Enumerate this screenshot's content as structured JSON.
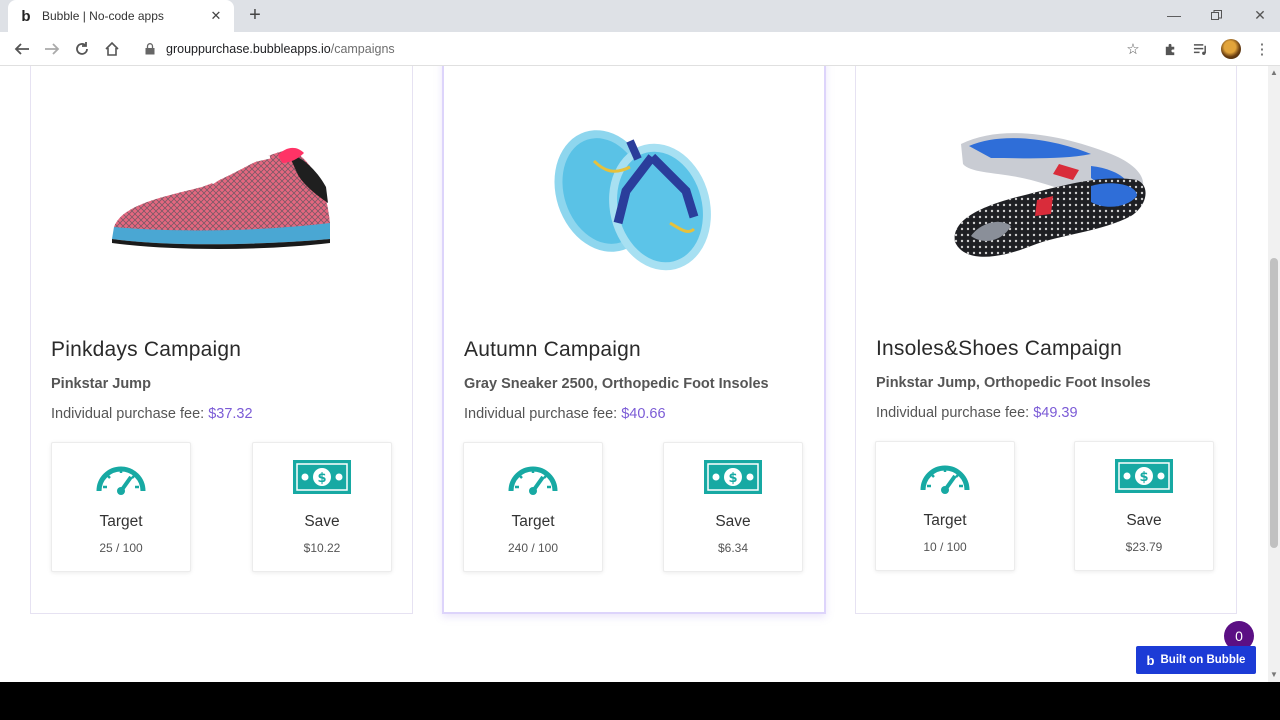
{
  "browser": {
    "tab_title": "Bubble | No-code apps",
    "tab_favicon": "b",
    "url_host": "grouppurchase.bubbleapps.io",
    "url_path": "/campaigns"
  },
  "colors": {
    "accent_purple": "#7b5bd6",
    "icon_teal": "#17a9a3",
    "bubble_blue": "#1c3bd6",
    "badge_purple": "#5b0f84"
  },
  "campaigns": [
    {
      "title": "Pinkdays Campaign",
      "products": "Pinkstar Jump",
      "fee_label": "Individual purchase fee:",
      "fee_amount": "$37.32",
      "target_label": "Target",
      "target_value": "25 / 100",
      "save_label": "Save",
      "save_value": "$10.22",
      "image": "pink-sneaker-image"
    },
    {
      "title": "Autumn Campaign",
      "products": "Gray Sneaker 2500, Orthopedic Foot Insoles",
      "fee_label": "Individual purchase fee:",
      "fee_amount": "$40.66",
      "target_label": "Target",
      "target_value": "240 / 100",
      "save_label": "Save",
      "save_value": "$6.34",
      "image": "flip-flops-image"
    },
    {
      "title": "Insoles&Shoes Campaign",
      "products": "Pinkstar Jump, Orthopedic Foot Insoles",
      "fee_label": "Individual purchase fee:",
      "fee_amount": "$49.39",
      "target_label": "Target",
      "target_value": "10 / 100",
      "save_label": "Save",
      "save_value": "$23.79",
      "image": "insoles-image"
    }
  ],
  "badge_count": "0",
  "built_on_label": "Built on Bubble"
}
